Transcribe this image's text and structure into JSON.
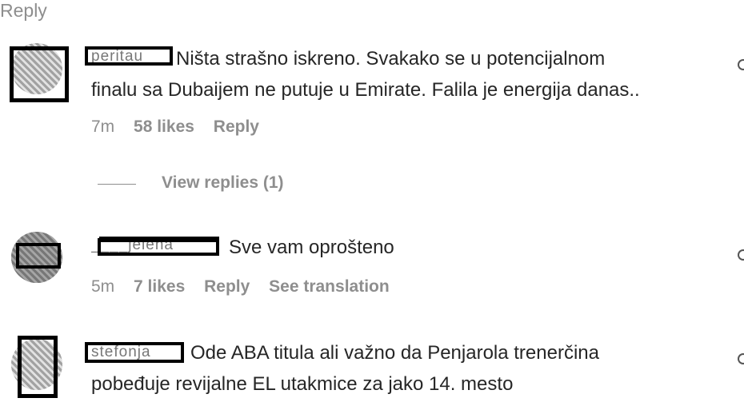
{
  "top_fragment": "Reply",
  "comments": [
    {
      "username_obscured": "peritau",
      "text_line1": "Ništa strašno iskreno. Svakako se u potencijalnom",
      "text_line2": "finalu sa Dubaijem ne putuje u Emirate. Falila je energija danas..",
      "time": "7m",
      "likes": "58 likes",
      "reply": "Reply",
      "view_replies": "View replies (1)"
    },
    {
      "username_obscured": "____jelena",
      "text_line1": "Sve vam oprošteno",
      "time": "5m",
      "likes": "7 likes",
      "reply": "Reply",
      "see_translation": "See translation"
    },
    {
      "username_obscured": "stefonja",
      "text_line1": "Ode ABA titula ali važno da Penjarola trenerčina",
      "text_line2": "pobeđuje revijalne EL utakmice za jako 14. mesto"
    }
  ],
  "icons": [
    "heart-icon",
    "heart-icon",
    "heart-icon"
  ]
}
